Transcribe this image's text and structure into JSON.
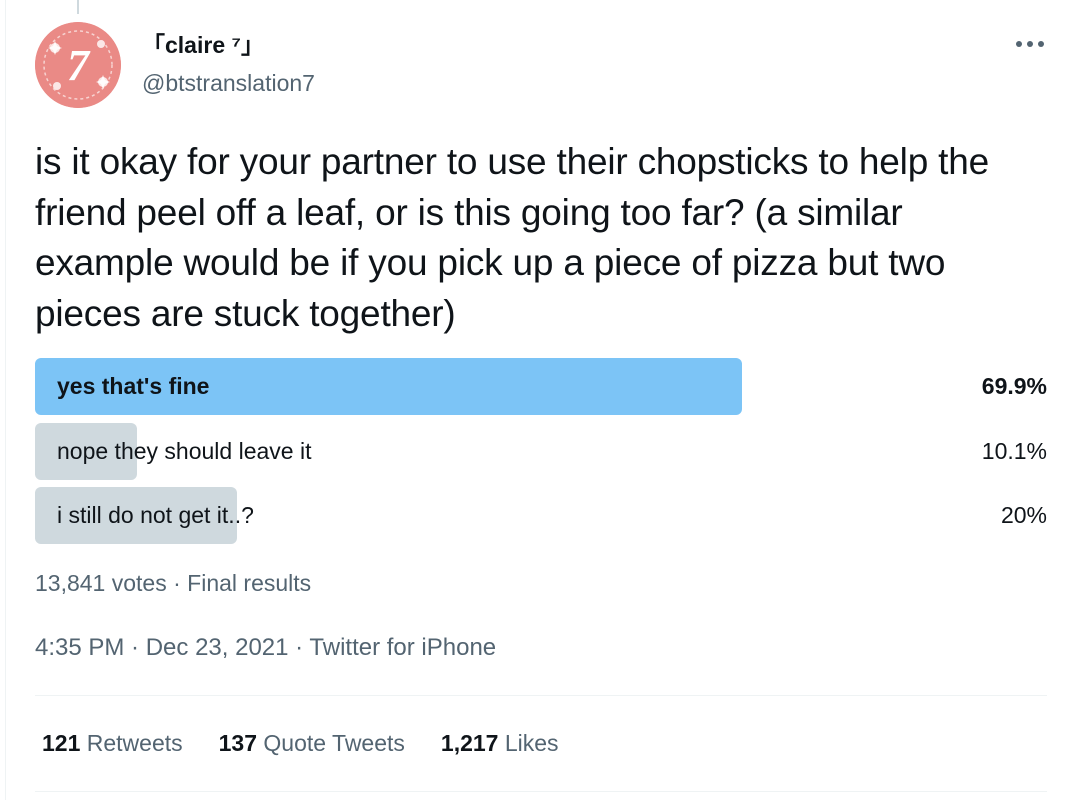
{
  "tweet": {
    "author": {
      "display_name": "「claire ⁷」",
      "handle": "@btstranslation7",
      "avatar_icon": "avatar-seven-floral"
    },
    "more_icon": "more-horizontal-icon",
    "text": "is it okay for your partner to use their chopsticks to help the friend peel off a leaf, or is this going too far? (a similar example would be if you pick up a piece of pizza but two pieces are stuck together)",
    "poll": {
      "options": [
        {
          "label": "yes that's fine",
          "percent_text": "69.9%",
          "percent": 69.9,
          "winner": true
        },
        {
          "label": "nope they should leave it",
          "percent_text": "10.1%",
          "percent": 10.1,
          "winner": false
        },
        {
          "label": "i still do not get it..?",
          "percent_text": "20%",
          "percent": 20,
          "winner": false
        }
      ],
      "votes": "13,841 votes",
      "separator": " · ",
      "status": "Final results"
    },
    "timestamp": {
      "time": "4:35 PM",
      "date": "Dec 23, 2021",
      "source": "Twitter for iPhone",
      "separator": " · "
    },
    "stats": {
      "retweets": {
        "count": "121",
        "label": "Retweets"
      },
      "quote_tweets": {
        "count": "137",
        "label": "Quote Tweets"
      },
      "likes": {
        "count": "1,217",
        "label": "Likes"
      }
    },
    "colors": {
      "winner_bar": "#7cc4f6",
      "other_bar": "#cfd9de",
      "secondary_text": "#536471",
      "avatar_bg": "#ea8a86"
    }
  }
}
